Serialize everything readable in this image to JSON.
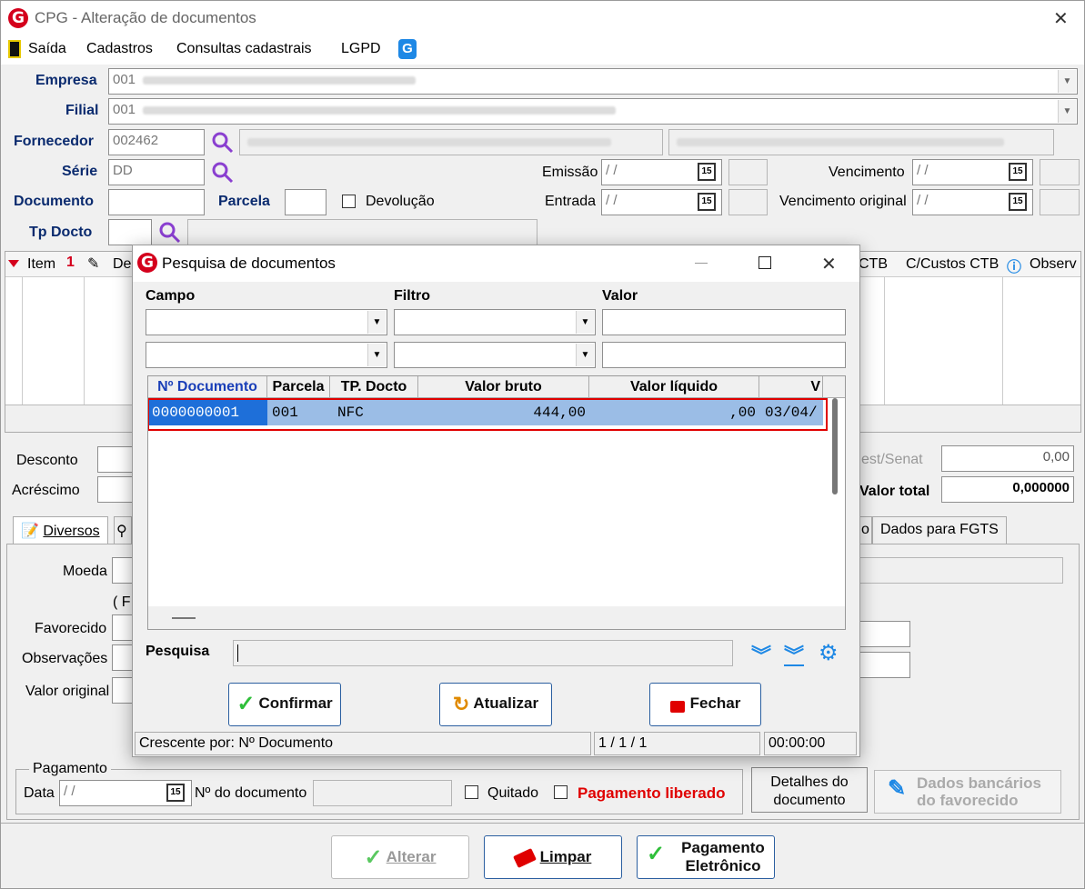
{
  "app": {
    "title": "CPG - Alteração de documentos",
    "logo_letter": "G"
  },
  "menu": {
    "items": [
      "Saída",
      "Cadastros",
      "Consultas cadastrais",
      "LGPD"
    ]
  },
  "form": {
    "empresa_label": "Empresa",
    "empresa_value": "001",
    "filial_label": "Filial",
    "filial_value": "001",
    "fornecedor_label": "Fornecedor",
    "fornecedor_value": "002462",
    "serie_label": "Série",
    "serie_value": "DD",
    "documento_label": "Documento",
    "parcela_label": "Parcela",
    "devolucao_label": "Devolução",
    "tpdocto_label": "Tp Docto",
    "emissao_label": "Emissão",
    "entrada_label": "Entrada",
    "vencimento_label": "Vencimento",
    "vencimento_original_label": "Vencimento original",
    "date_placeholder": "/ /",
    "cal_label": "15"
  },
  "grid": {
    "col_item": "Item",
    "col_de": "De",
    "col_ctb": "CTB",
    "col_ccustos": "C/Custos CTB",
    "col_observ": "Observ"
  },
  "totals": {
    "desconto_label": "Desconto",
    "acrescimo_label": "Acréscimo",
    "sestsenat_label": "est/Senat",
    "sestsenat_value": "0,00",
    "valortotal_label": "Valor total",
    "valortotal_value": "0,000000"
  },
  "tabs": {
    "diversos": "Diversos",
    "partial_o": "o",
    "fgts": "Dados para FGTS"
  },
  "diversos": {
    "moeda_label": "Moeda",
    "paren_label": "( F",
    "favorecido_label": "Favorecido",
    "observacoes_label": "Observações",
    "valororiginal_label": "Valor original"
  },
  "pagamento": {
    "group_label": "Pagamento",
    "data_label": "Data",
    "data_value": "/ /",
    "ndoc_label": "Nº do documento",
    "quitado_label": "Quitado",
    "liberado_label": "Pagamento liberado",
    "detalhes_line1": "Detalhes do",
    "detalhes_line2": "documento",
    "bancarios_line1": "Dados bancários",
    "bancarios_line2": "do favorecido"
  },
  "bottom_buttons": {
    "alterar": "Alterar",
    "limpar": "Limpar",
    "eletronico_line1": "Pagamento",
    "eletronico_line2": "Eletrônico"
  },
  "dialog": {
    "title": "Pesquisa de documentos",
    "campo_label": "Campo",
    "filtro_label": "Filtro",
    "valor_label": "Valor",
    "columns": [
      "Nº Documento",
      "Parcela",
      "TP. Docto",
      "Valor bruto",
      "Valor líquido",
      "V"
    ],
    "row": {
      "documento": "0000000001",
      "parcela": "001",
      "tpdocto": "NFC",
      "valor_bruto": "444,00",
      "valor_liquido": ",00",
      "v": "03/04/"
    },
    "pesquisa_label": "Pesquisa",
    "confirmar": "Confirmar",
    "atualizar": "Atualizar",
    "fechar": "Fechar",
    "status_sort": "Crescente por: Nº Documento",
    "status_count": "1 / 1 / 1",
    "status_time": "00:00:00"
  },
  "colors": {
    "brand_red": "#d4001c",
    "label_blue": "#0a2a6e",
    "highlight_red": "#e00000",
    "selection_blue": "#9bbde6",
    "accent_blue": "#1e88e5"
  }
}
